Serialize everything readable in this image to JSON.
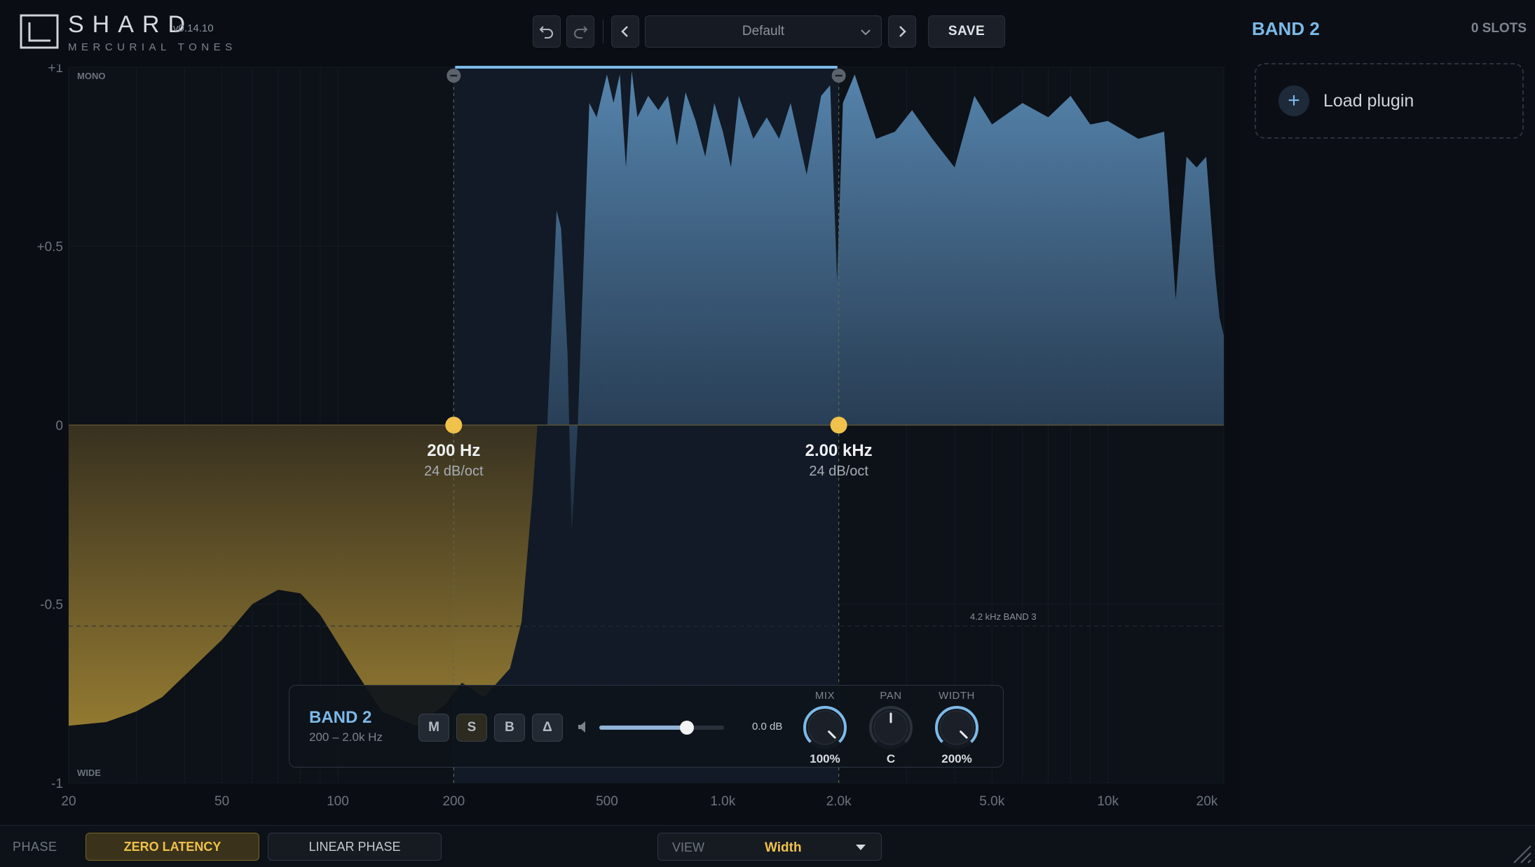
{
  "app": {
    "name": "SHARD",
    "version": "v0.14.10",
    "subtitle": "MERCURIAL TONES"
  },
  "toolbar": {
    "undo_icon": "undo-icon",
    "redo_icon": "redo-icon",
    "prev_icon": "chevron-left-icon",
    "next_icon": "chevron-right-icon",
    "preset": "Default",
    "save_label": "SAVE"
  },
  "graph": {
    "y_ticks": [
      "+1",
      "+0.5",
      "0",
      "-0.5",
      "-1"
    ],
    "x_ticks": [
      "20",
      "50",
      "100",
      "200",
      "500",
      "1.0k",
      "2.0k",
      "5.0k",
      "10k",
      "20k"
    ],
    "mono_label": "MONO",
    "wide_label": "WIDE",
    "crossovers": [
      {
        "freq": "200 Hz",
        "slope": "24 dB/oct",
        "hz": 200
      },
      {
        "freq": "2.00 kHz",
        "slope": "24 dB/oct",
        "hz": 2000
      }
    ],
    "band3_marker": {
      "freq": "4.2 kHz",
      "label": "BAND 3"
    },
    "colors": {
      "accent_blue": "#7cb9e8",
      "accent_yellow": "#f0c14b",
      "spectrum_blue": "#4a7ca6",
      "spectrum_yellow": "#8a7028"
    }
  },
  "band_strip": {
    "name": "BAND 2",
    "range": "200 – 2.0k Hz",
    "buttons": [
      "M",
      "S",
      "B",
      "Δ"
    ],
    "volume": {
      "value": "0.0 dB",
      "level": 0.7
    },
    "knobs": [
      {
        "label": "MIX",
        "value": "100%",
        "level": 1.0
      },
      {
        "label": "PAN",
        "value": "C",
        "level": 0.5
      },
      {
        "label": "WIDTH",
        "value": "200%",
        "level": 1.0
      }
    ]
  },
  "right_panel": {
    "title": "BAND 2",
    "slots": "0 SLOTS",
    "load_plugin": "Load plugin"
  },
  "footer": {
    "phase_label": "PHASE",
    "zero_latency": "ZERO LATENCY",
    "linear_phase": "LINEAR PHASE",
    "view_label": "VIEW",
    "view_value": "Width"
  }
}
